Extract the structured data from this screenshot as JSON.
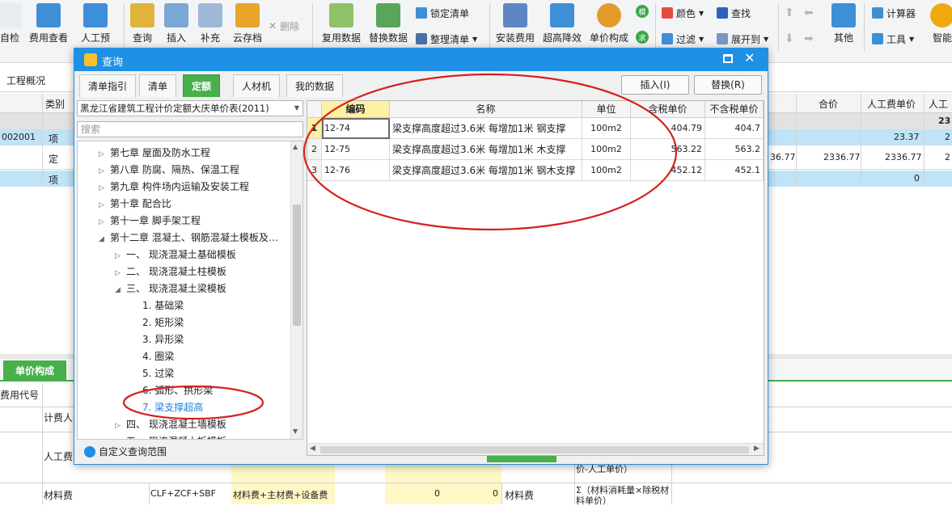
{
  "toolbar": {
    "buttons": [
      {
        "label": "自检"
      },
      {
        "label": "费用查看"
      },
      {
        "label": "人工预"
      },
      {
        "label": "查询"
      },
      {
        "label": "插入"
      },
      {
        "label": "补充"
      },
      {
        "label": "云存档"
      },
      {
        "label": "复用数据"
      },
      {
        "label": "替换数据"
      },
      {
        "label": "安装费用"
      },
      {
        "label": "超高降效"
      },
      {
        "label": "单价构成"
      },
      {
        "label": "其他"
      },
      {
        "label": "智能"
      }
    ],
    "small": {
      "delete": "删除",
      "lock_list": "锁定清单",
      "organize_list": "整理清单",
      "color": "颜色",
      "find": "查找",
      "filter": "过滤",
      "expand_to": "展开到",
      "calculator": "计算器",
      "tools": "工具",
      "mo": "模",
      "qiu": "求"
    }
  },
  "bg": {
    "tab_label": "工程概况",
    "col_category": "类别",
    "col_total": "合价",
    "col_labor_unit": "人工费单价",
    "col_labor": "人工",
    "row1_code": "002001",
    "row1_type": "项",
    "row1_labor": "23.37",
    "row1_extra": "23",
    "row1_tail": "2",
    "row2_type": "定",
    "row2_v1": "36.77",
    "row2_v2": "2336.77",
    "row2_v3": "2336.77",
    "row2_tail": "2",
    "row3_type": "项",
    "row3_v": "0",
    "lower_tab": "单价构成",
    "lower_col": "费用代号",
    "lower_r1": "计费人",
    "lower_r2": "人工费",
    "lower_r3": "材料费",
    "lower_r3_formula": "CLF+ZCF+SBF",
    "lower_r3_name": "材料费+主材费+设备费",
    "lower_r3_v1": "0",
    "lower_r3_v2": "0",
    "lower_r3_cat": "材料费",
    "lower_r3_desc": "Σ（材料消耗量×除税材料单价）",
    "lower_r2_desc": "价-人工单价）"
  },
  "dialog": {
    "title": "查询",
    "tabs": [
      "清单指引",
      "清单",
      "定额",
      "人材机",
      "我的数据"
    ],
    "active_tab": "定额",
    "insert_button": "插入(I)",
    "replace_button": "替换(R)",
    "library": "黑龙江省建筑工程计价定额大庆单价表(2011)",
    "search_placeholder": "搜索",
    "tree": [
      {
        "label": "第七章 屋面及防水工程",
        "level": 0,
        "arrow": "▷"
      },
      {
        "label": "第八章 防腐、隔热、保温工程",
        "level": 0,
        "arrow": "▷"
      },
      {
        "label": "第九章 构件场内运输及安装工程",
        "level": 0,
        "arrow": "▷"
      },
      {
        "label": "第十章 配合比",
        "level": 0,
        "arrow": "▷"
      },
      {
        "label": "第十一章 脚手架工程",
        "level": 0,
        "arrow": "▷"
      },
      {
        "label": "第十二章 混凝土、钢筋混凝土模板及…",
        "level": 0,
        "arrow": "◢"
      },
      {
        "label": "一、 现浇混凝土基础模板",
        "level": 1,
        "arrow": "▷"
      },
      {
        "label": "二、 现浇混凝土柱模板",
        "level": 1,
        "arrow": "▷"
      },
      {
        "label": "三、 现浇混凝土梁模板",
        "level": 1,
        "arrow": "◢"
      },
      {
        "label": "1. 基础梁",
        "level": 2,
        "arrow": ""
      },
      {
        "label": "2. 矩形梁",
        "level": 2,
        "arrow": ""
      },
      {
        "label": "3. 异形梁",
        "level": 2,
        "arrow": ""
      },
      {
        "label": "4. 圈梁",
        "level": 2,
        "arrow": ""
      },
      {
        "label": "5. 过梁",
        "level": 2,
        "arrow": ""
      },
      {
        "label": "6. 弧形、拱形梁",
        "level": 2,
        "arrow": ""
      },
      {
        "label": "7. 梁支撑超高",
        "level": 2,
        "arrow": "",
        "selected": true
      },
      {
        "label": "四、 现浇混凝土墙模板",
        "level": 1,
        "arrow": "▷"
      },
      {
        "label": "五、 现浇混凝土板模板",
        "level": 1,
        "arrow": "▷"
      }
    ],
    "grid": {
      "headers": [
        "",
        "编码",
        "名称",
        "单位",
        "含税单价",
        "不含税单价"
      ],
      "rows": [
        {
          "no": "1",
          "code": "12-74",
          "name": "梁支撑高度超过3.6米 每增加1米 钢支撑",
          "unit": "100m2",
          "price_tax": "404.79",
          "price_notax": "404.7"
        },
        {
          "no": "2",
          "code": "12-75",
          "name": "梁支撑高度超过3.6米 每增加1米 木支撑",
          "unit": "100m2",
          "price_tax": "563.22",
          "price_notax": "563.2"
        },
        {
          "no": "3",
          "code": "12-76",
          "name": "梁支撑高度超过3.6米 每增加1米 钢木支撑",
          "unit": "100m2",
          "price_tax": "452.12",
          "price_notax": "452.1"
        }
      ]
    },
    "custom_range": "自定义查询范围"
  },
  "colors": {
    "accent": "#1e90e6",
    "tab_green": "#47b04b",
    "annotation": "#d42020",
    "selected_row": "#bfe3f7"
  }
}
